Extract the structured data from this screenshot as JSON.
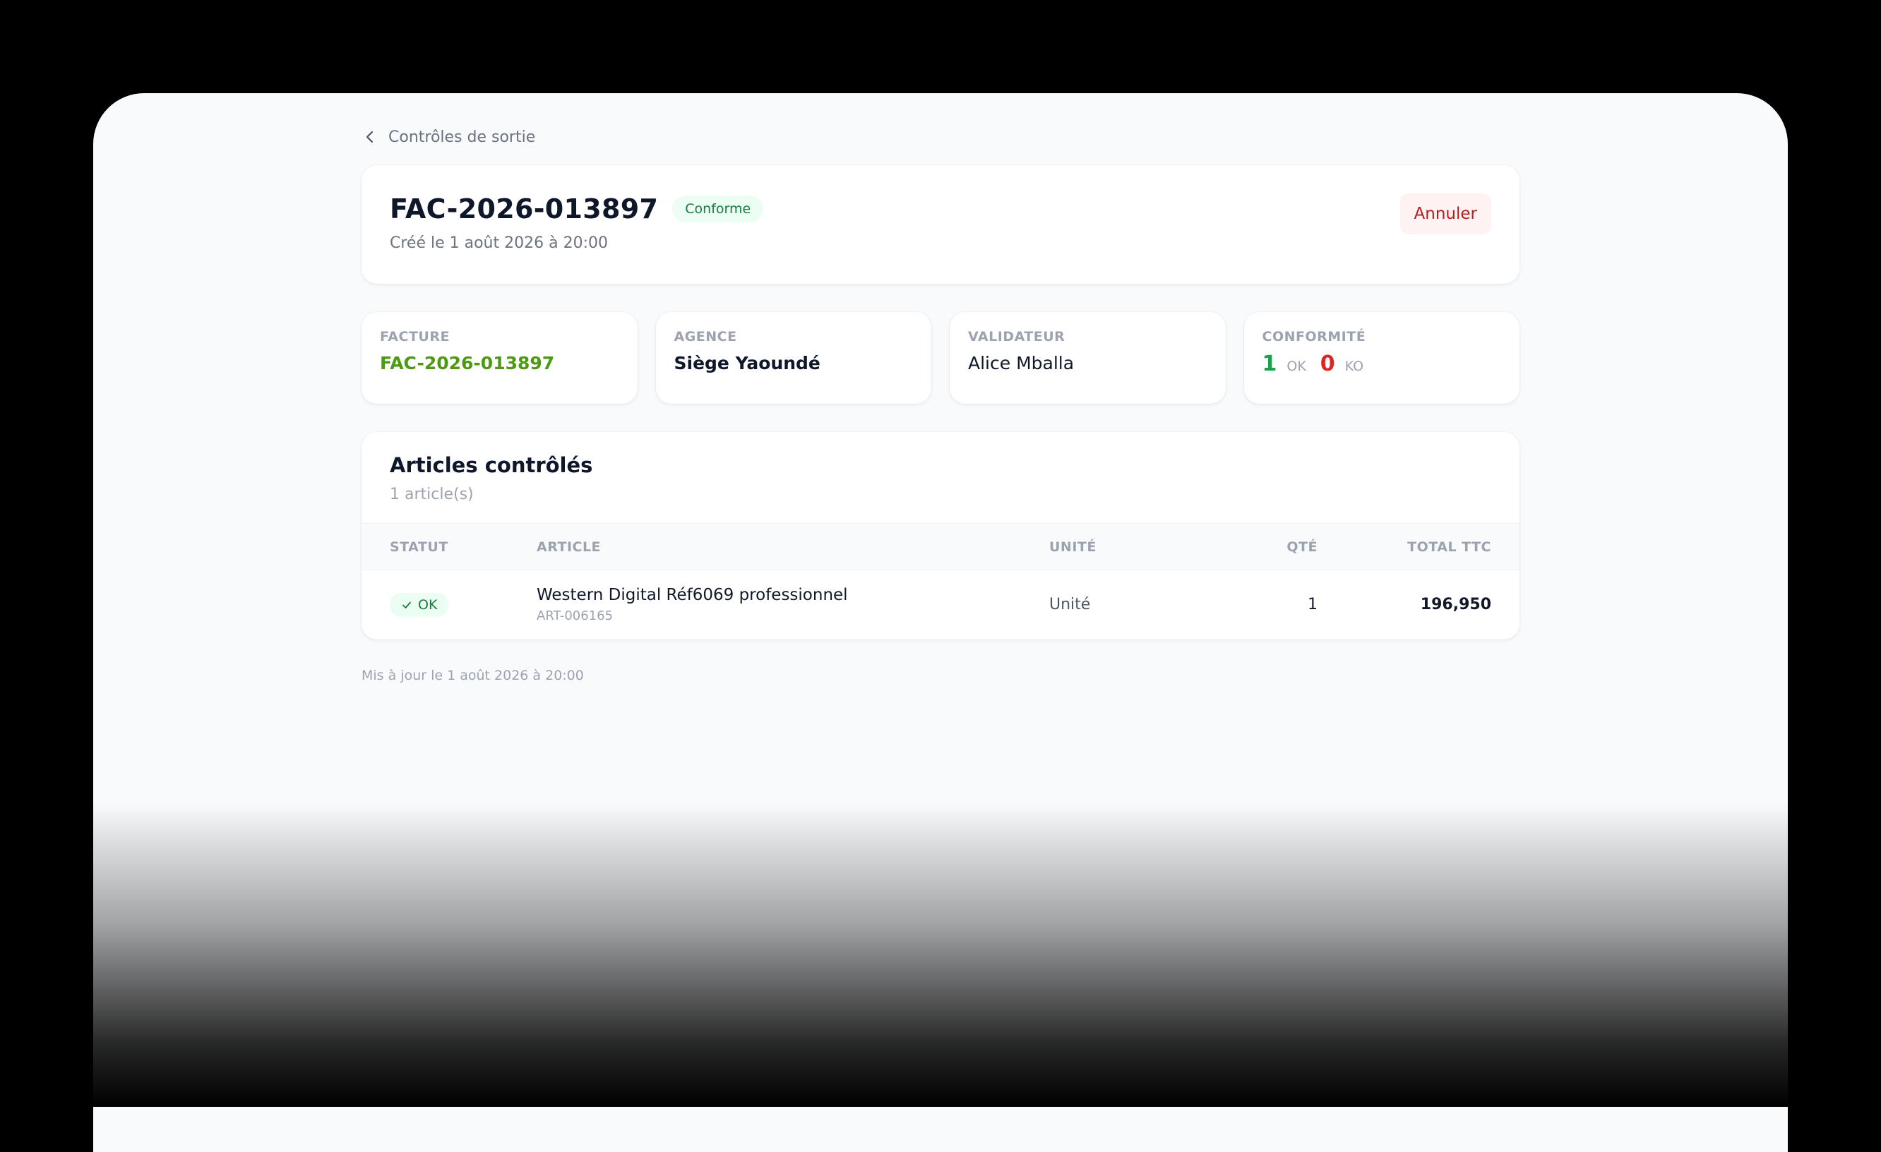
{
  "breadcrumb": {
    "label": "Contrôles de sortie",
    "icon": "chevron-left-icon"
  },
  "header": {
    "title": "FAC-2026-013897",
    "status_badge": "Conforme",
    "created": "Créé le 1 août 2026 à 20:00",
    "cancel_label": "Annuler"
  },
  "stats": {
    "facture": {
      "label": "FACTURE",
      "value": "FAC-2026-013897"
    },
    "agence": {
      "label": "AGENCE",
      "value": "Siège Yaoundé"
    },
    "validateur": {
      "label": "VALIDATEUR",
      "value": "Alice Mballa"
    },
    "conformite": {
      "label": "CONFORMITÉ",
      "ok_count": "1",
      "ok_label": "OK",
      "ko_count": "0",
      "ko_label": "KO"
    }
  },
  "articles": {
    "title": "Articles contrôlés",
    "count": "1 article(s)",
    "columns": [
      "STATUT",
      "ARTICLE",
      "UNITÉ",
      "QTÉ",
      "TOTAL TTC"
    ],
    "rows": [
      {
        "status": "OK",
        "name": "Western Digital Réf6069 professionnel",
        "ref": "ART-006165",
        "unit": "Unité",
        "qty": "1",
        "total": "196,950"
      }
    ]
  },
  "footer": {
    "updated": "Mis à jour le 1 août 2026 à 20:00"
  },
  "colors": {
    "accent_green": "#4d9a12",
    "ok_green": "#16a34a",
    "ko_red": "#dc2626",
    "cancel_red": "#b91c1c"
  }
}
